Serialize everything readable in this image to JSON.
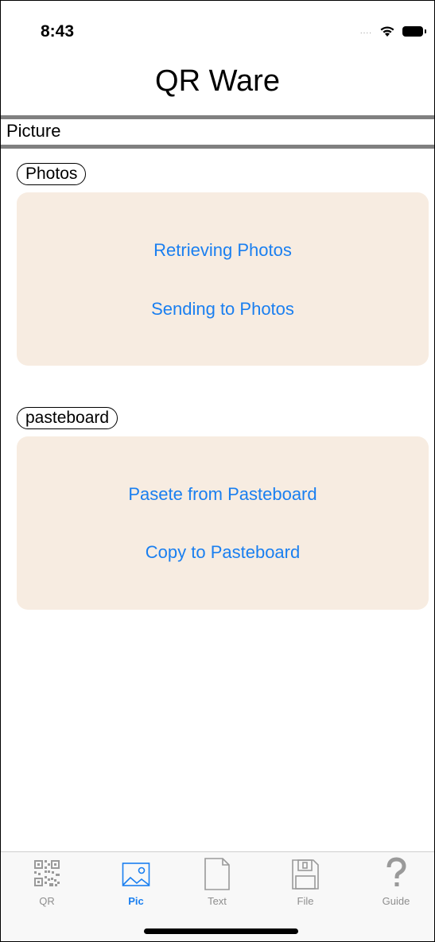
{
  "status_bar": {
    "time": "8:43",
    "signal": "....",
    "wifi_icon": "wifi-icon",
    "battery_icon": "battery-icon"
  },
  "app": {
    "title": "QR Ware"
  },
  "section": {
    "header": "Picture"
  },
  "photos_group": {
    "label": "Photos",
    "buttons": [
      "Retrieving Photos",
      "Sending to Photos"
    ]
  },
  "pasteboard_group": {
    "label": "pasteboard",
    "buttons": [
      "Pasete from Pasteboard",
      "Copy to Pasteboard"
    ]
  },
  "tab_bar": {
    "tabs": [
      {
        "label": "QR",
        "icon": "qr-code-icon",
        "active": false
      },
      {
        "label": "Pic",
        "icon": "picture-icon",
        "active": true
      },
      {
        "label": "Text",
        "icon": "document-icon",
        "active": false
      },
      {
        "label": "File",
        "icon": "floppy-disk-icon",
        "active": false
      },
      {
        "label": "Guide",
        "icon": "question-mark-icon",
        "active": false
      }
    ]
  },
  "colors": {
    "accent": "#1a7ff0",
    "card_background": "#f7ece1",
    "divider": "#808080",
    "tab_inactive": "#8e8e8e"
  }
}
